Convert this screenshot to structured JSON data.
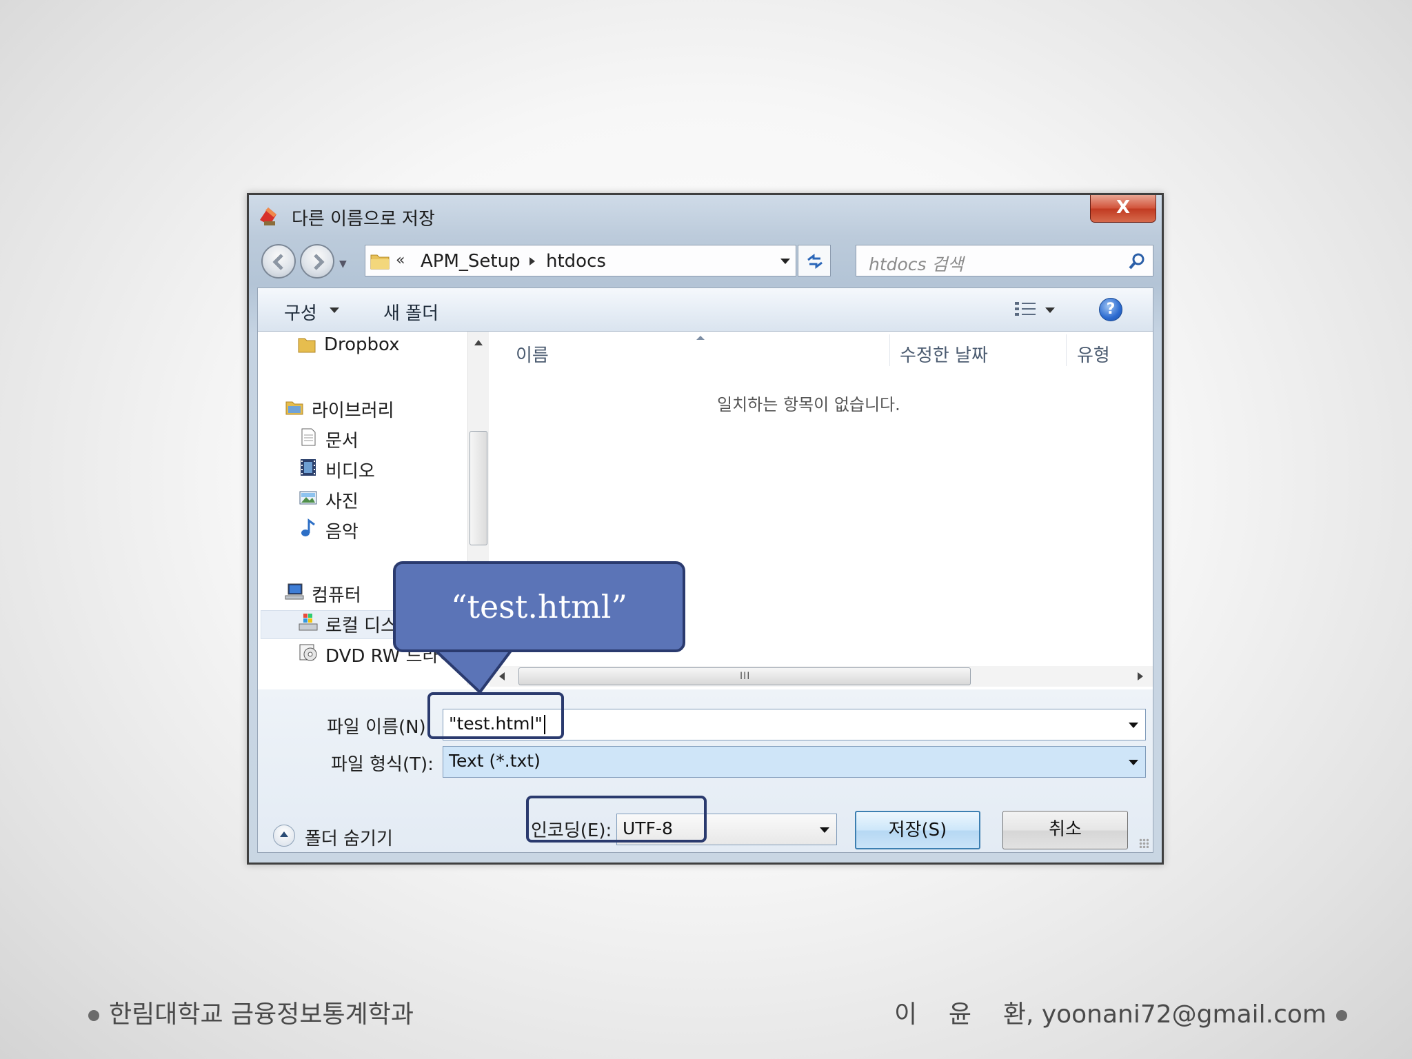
{
  "dialog": {
    "title": "다른 이름으로 저장",
    "close_label": "X"
  },
  "address": {
    "chevron": "«",
    "segments": [
      "APM_Setup",
      "htdocs"
    ]
  },
  "search": {
    "placeholder": "htdocs 검색"
  },
  "toolbar": {
    "organize_label": "구성",
    "new_folder_label": "새 폴더",
    "help_label": "?"
  },
  "nav": {
    "items": [
      {
        "label": "Dropbox",
        "icon": "folder-icon"
      },
      {
        "label": "라이브러리",
        "icon": "library-icon"
      },
      {
        "label": "문서",
        "icon": "document-icon"
      },
      {
        "label": "비디오",
        "icon": "video-icon"
      },
      {
        "label": "사진",
        "icon": "picture-icon"
      },
      {
        "label": "음악",
        "icon": "music-icon"
      },
      {
        "label": "컴퓨터",
        "icon": "computer-icon"
      },
      {
        "label": "로컬 디스크 (C:)",
        "icon": "local-disk-icon"
      },
      {
        "label": "DVD RW 드라이브",
        "icon": "dvd-drive-icon"
      }
    ]
  },
  "content": {
    "columns": [
      "이름",
      "수정한 날짜",
      "유형"
    ],
    "empty_message": "일치하는 항목이 없습니다."
  },
  "form": {
    "filename_label": "파일 이름(N):",
    "filename_value": "\"test.html\"",
    "filetype_label": "파일 형식(T):",
    "filetype_value": "Text (*.txt)",
    "encoding_label": "인코딩(E):",
    "encoding_value": "UTF-8",
    "hide_folders_label": "폴더 숨기기",
    "save_label": "저장(S)",
    "cancel_label": "취소"
  },
  "annotation": {
    "callout_text": "“test.html”"
  },
  "footer": {
    "left": "한림대학교 금융정보통계학과",
    "right": "이    윤    환, yoonani72@gmail.com"
  },
  "colors": {
    "callout_fill": "#5b74b7",
    "highlight_border": "#2a3a6e",
    "close_button": "#c13b22"
  }
}
